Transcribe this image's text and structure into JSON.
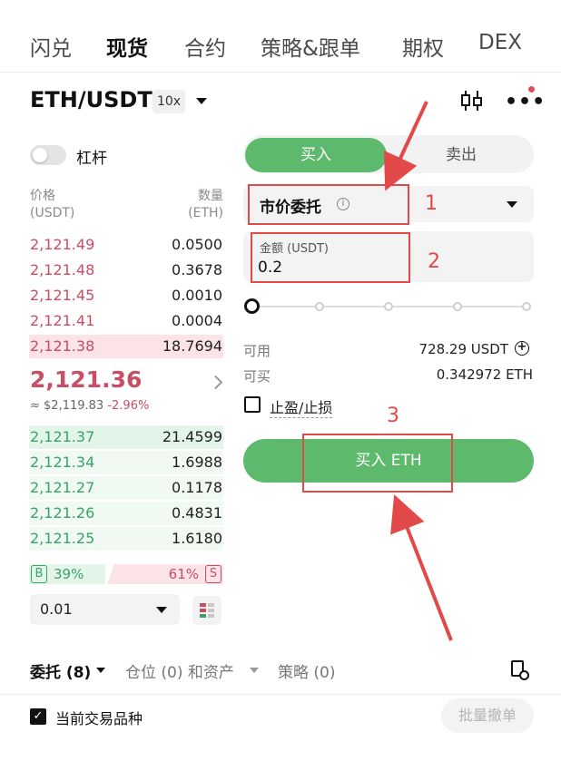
{
  "top_tabs": [
    {
      "label": "闪兑"
    },
    {
      "label": "现货"
    },
    {
      "label": "合约"
    },
    {
      "label": "策略&跟单"
    },
    {
      "label": "期权"
    },
    {
      "label": "DEX"
    }
  ],
  "active_top_tab": "现货",
  "pair": {
    "symbol": "ETH/USDT",
    "leverage": "10x"
  },
  "order_book": {
    "leverage_toggle_label": "杠杆",
    "leverage_toggle_on": false,
    "price_header": "价格",
    "price_unit": "(USDT)",
    "qty_header": "数量",
    "qty_unit": "(ETH)",
    "asks": [
      {
        "price": "2,121.49",
        "qty": "0.0500"
      },
      {
        "price": "2,121.48",
        "qty": "0.3678"
      },
      {
        "price": "2,121.45",
        "qty": "0.0010"
      },
      {
        "price": "2,121.41",
        "qty": "0.0004"
      },
      {
        "price": "2,121.38",
        "qty": "18.7694"
      }
    ],
    "last_price": "2,121.36",
    "last_price_usd": "≈ $2,119.83",
    "change_pct": "-2.96%",
    "bids": [
      {
        "price": "2,121.37",
        "qty": "21.4599"
      },
      {
        "price": "2,121.34",
        "qty": "1.6988"
      },
      {
        "price": "2,121.27",
        "qty": "0.1178"
      },
      {
        "price": "2,121.26",
        "qty": "0.4831"
      },
      {
        "price": "2,121.25",
        "qty": "1.6180"
      }
    ],
    "buy_badge": "B",
    "buy_ratio": "39%",
    "sell_ratio": "61%",
    "sell_badge": "S",
    "precision": "0.01"
  },
  "trade_form": {
    "buy_tab": "买入",
    "sell_tab": "卖出",
    "order_type": "市价委托",
    "amount_label": "金额 (USDT)",
    "amount_value": "0.2",
    "slider_percent": 0,
    "available_label": "可用",
    "available_value": "728.29 USDT",
    "can_buy_label": "可买",
    "can_buy_value": "0.342972 ETH",
    "tpsl_label": "止盈/止损",
    "tpsl_checked": false,
    "submit_label": "买入 ETH"
  },
  "bottom_tabs": [
    {
      "label": "委托 (8)"
    },
    {
      "label": "仓位 (0) 和资产"
    },
    {
      "label": "策略 (0)"
    }
  ],
  "bottom": {
    "current_pair_only_label": "当前交易品种",
    "current_pair_only_checked": true,
    "batch_cancel_label": "批量撤单"
  },
  "annotations": [
    {
      "number": "1"
    },
    {
      "number": "2"
    },
    {
      "number": "3"
    }
  ],
  "colors": {
    "buy": "#5db96b",
    "ask_price": "#c94d63",
    "bid_price": "#39a36a",
    "annotation": "#e24a4a"
  }
}
